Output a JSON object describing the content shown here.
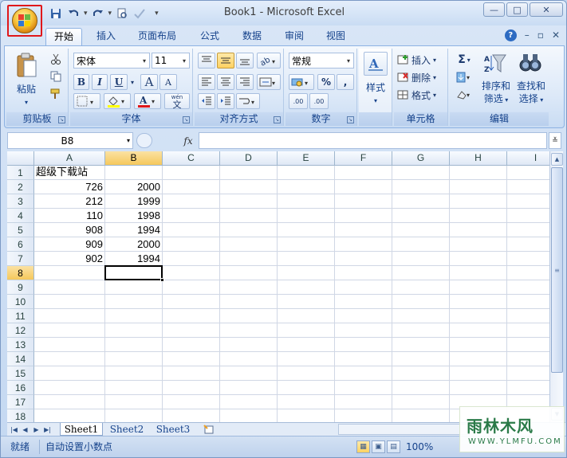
{
  "window": {
    "title": "Book1 - Microsoft Excel",
    "minimize_symbol": "—",
    "maximize_symbol": "□",
    "close_symbol": "✕"
  },
  "ribbon_tabs": [
    {
      "label": "开始"
    },
    {
      "label": "插入"
    },
    {
      "label": "页面布局"
    },
    {
      "label": "公式"
    },
    {
      "label": "数据"
    },
    {
      "label": "审阅"
    },
    {
      "label": "视图"
    }
  ],
  "ribbon_tab_right": {
    "minimize": "–",
    "restore": "▫",
    "close": "✕"
  },
  "clipboard": {
    "paste_label": "粘贴",
    "group_label": "剪贴板"
  },
  "font": {
    "name": "宋体",
    "size": "11",
    "group_label": "字体",
    "bold": "B",
    "italic": "I",
    "underline": "U",
    "grow": "A",
    "shrink": "A",
    "color_a": "A",
    "phonetic_top": "wén",
    "phonetic_char": "文"
  },
  "alignment": {
    "group_label": "对齐方式"
  },
  "number": {
    "format": "常规",
    "group_label": "数字",
    "percent": "%",
    "comma": ",",
    "inc_decimal": ".00",
    "dec_decimal": ".00"
  },
  "styles": {
    "label": "样式"
  },
  "cells": {
    "insert": "插入",
    "delete": "删除",
    "format": "格式",
    "group_label": "单元格"
  },
  "editing": {
    "sum_symbol": "Σ",
    "sort_label_1": "排序和",
    "sort_label_2": "筛选",
    "find_label_1": "查找和",
    "find_label_2": "选择",
    "group_label": "编辑"
  },
  "formula_bar": {
    "name_box": "B8",
    "fx": "fx",
    "value": ""
  },
  "grid": {
    "columns": [
      "A",
      "B",
      "C",
      "D",
      "E",
      "F",
      "G",
      "H",
      "I"
    ],
    "rows": [
      "1",
      "2",
      "3",
      "4",
      "5",
      "6",
      "7",
      "8",
      "9",
      "10",
      "11",
      "12",
      "13",
      "14",
      "15",
      "16",
      "17",
      "18"
    ],
    "selected_cell": "B8",
    "cells": {
      "A1": "超级下载站",
      "A2": "726",
      "B2": "2000",
      "A3": "212",
      "B3": "1999",
      "A4": "110",
      "B4": "1998",
      "A5": "908",
      "B5": "1994",
      "A6": "909",
      "B6": "2000",
      "A7": "902",
      "B7": "1994"
    }
  },
  "sheets": [
    {
      "label": "Sheet1",
      "active": true
    },
    {
      "label": "Sheet2",
      "active": false
    },
    {
      "label": "Sheet3",
      "active": false
    }
  ],
  "status": {
    "ready": "就绪",
    "mode": "自动设置小数点",
    "zoom": "100%"
  },
  "watermark": {
    "main": "雨林木风",
    "sub": "WWW.YLMFU.COM"
  }
}
